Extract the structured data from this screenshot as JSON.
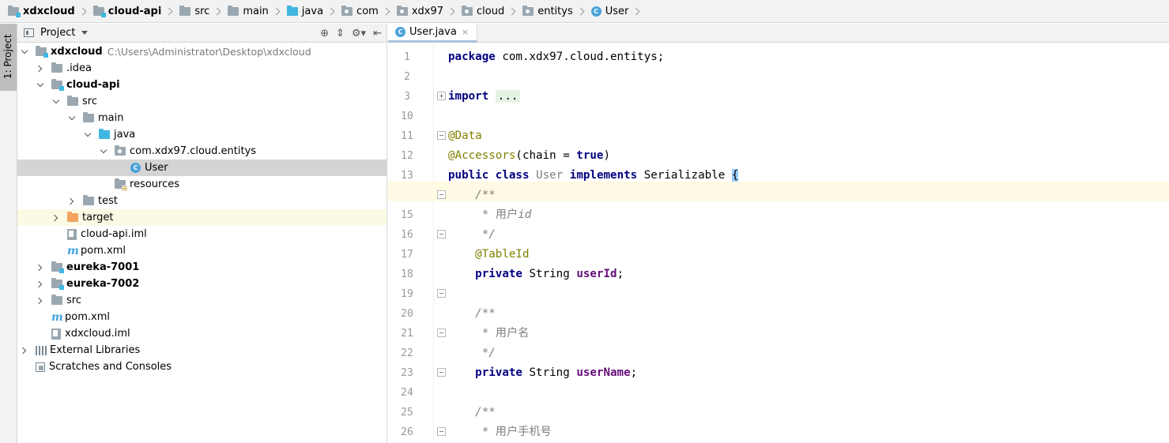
{
  "breadcrumb": {
    "items": [
      {
        "label": "xdxcloud",
        "bold": true,
        "icon": "module-folder-icon"
      },
      {
        "label": "cloud-api",
        "bold": true,
        "icon": "module-folder-icon"
      },
      {
        "label": "src",
        "icon": "folder-icon"
      },
      {
        "label": "main",
        "icon": "folder-icon"
      },
      {
        "label": "java",
        "icon": "source-folder-icon"
      },
      {
        "label": "com",
        "icon": "package-icon"
      },
      {
        "label": "xdx97",
        "icon": "package-icon"
      },
      {
        "label": "cloud",
        "icon": "package-icon"
      },
      {
        "label": "entitys",
        "icon": "package-icon"
      },
      {
        "label": "User",
        "icon": "class-icon"
      }
    ]
  },
  "tool_strip": {
    "project_label": "1: Project"
  },
  "project_panel": {
    "title": "Project",
    "tree": [
      {
        "label": "xdxcloud",
        "path": "C:\\Users\\Administrator\\Desktop\\xdxcloud",
        "bold": true
      },
      {
        "label": ".idea"
      },
      {
        "label": "cloud-api",
        "bold": true
      },
      {
        "label": "src"
      },
      {
        "label": "main"
      },
      {
        "label": "java"
      },
      {
        "label": "com.xdx97.cloud.entitys"
      },
      {
        "label": "User",
        "class_badge": "C"
      },
      {
        "label": "resources"
      },
      {
        "label": "test"
      },
      {
        "label": "target"
      },
      {
        "label": "cloud-api.iml"
      },
      {
        "label": "pom.xml",
        "badge": "m"
      },
      {
        "label": "eureka-7001",
        "bold": true
      },
      {
        "label": "eureka-7002",
        "bold": true
      },
      {
        "label": "src"
      },
      {
        "label": "pom.xml",
        "badge": "m"
      },
      {
        "label": "xdxcloud.iml"
      },
      {
        "label": "External Libraries"
      },
      {
        "label": "Scratches and Consoles"
      }
    ]
  },
  "editor": {
    "tab": {
      "label": "User.java",
      "badge": "C",
      "close": "×"
    },
    "line_numbers": [
      "1",
      "2",
      "3",
      "10",
      "11",
      "12",
      "13",
      "14",
      "15",
      "16",
      "17",
      "18",
      "19",
      "20",
      "21",
      "22",
      "23",
      "24",
      "25",
      "26"
    ],
    "code": {
      "l1_kw": "package",
      "l1_rest": " com.xdx97.cloud.entitys;",
      "l3_kw": "import",
      "l3_fold": "...",
      "l11_ann": "@Data",
      "l12_ann": "@Accessors",
      "l12_rest": "(chain = ",
      "l12_kw": "true",
      "l12_end": ")",
      "l13_kw1": "public",
      "l13_kw2": "class",
      "l13_name": "User",
      "l13_kw3": "implements",
      "l13_iface": "Serializable",
      "l13_brace": "{",
      "l14": "    /**",
      "l15_star": "     * ",
      "l15_zh": "用户",
      "l15_id": "id",
      "l16": "     */",
      "l17_ann": "    @TableId",
      "l18_kw": "    private",
      "l18_type": " String ",
      "l18_field": "userId",
      "l18_semi": ";",
      "l20": "    /**",
      "l21_star": "     * ",
      "l21_zh": "用户名",
      "l22": "     */",
      "l23_kw": "    private",
      "l23_type": " String ",
      "l23_field": "userName",
      "l23_semi": ";",
      "l25": "    /**",
      "l26_star": "     * ",
      "l26_zh": "用户手机号"
    }
  },
  "colors": {
    "keyword": "#000080",
    "annotation": "#808000",
    "comment": "#808080",
    "field": "#660e7a",
    "caret_line": "#fffae3",
    "selection": "#d4d4d4"
  }
}
